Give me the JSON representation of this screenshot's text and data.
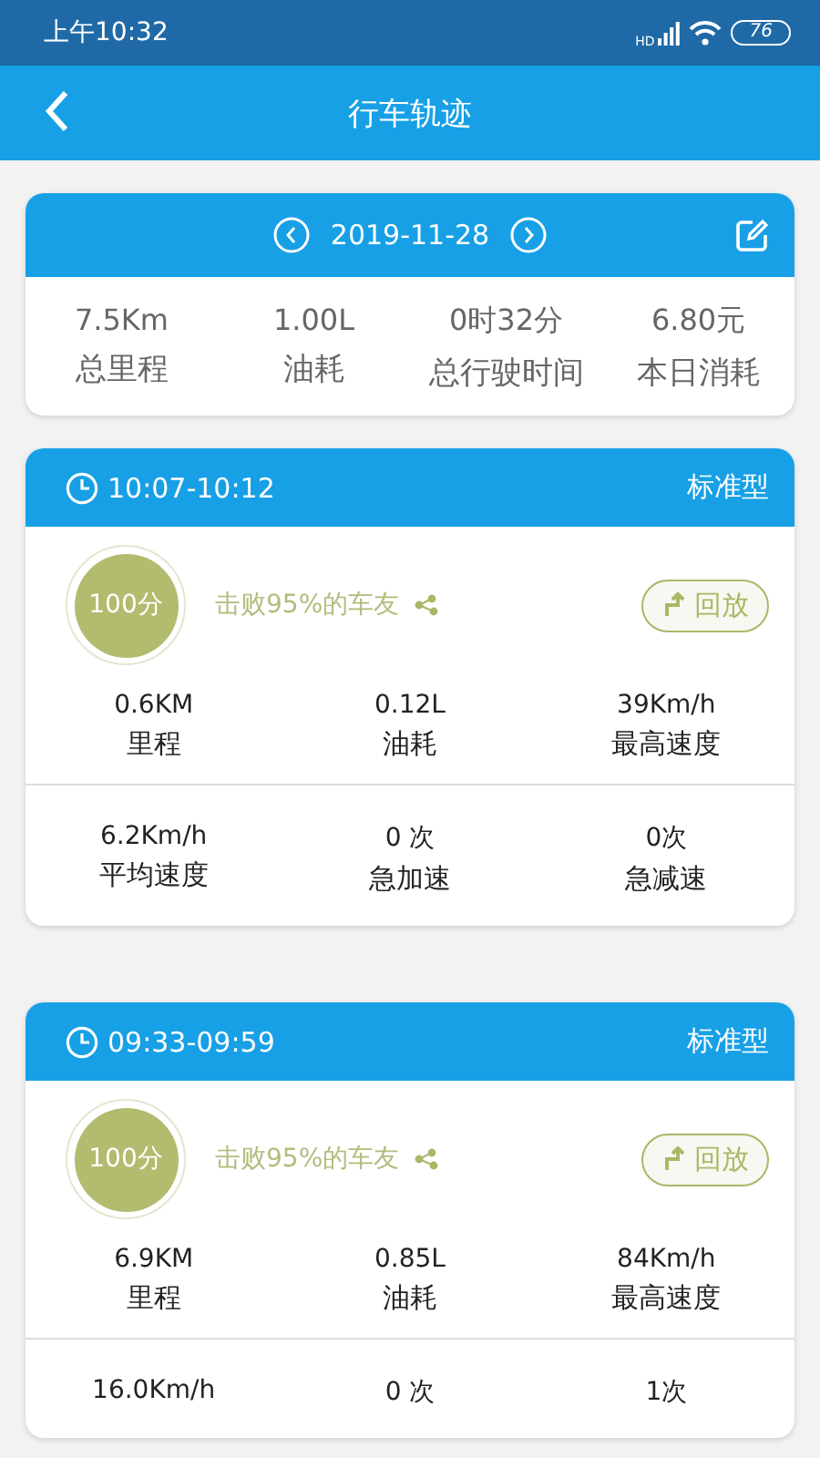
{
  "status_bar": {
    "time": "上午10:32",
    "network": "HD",
    "battery": "76"
  },
  "header": {
    "title": "行车轨迹"
  },
  "summary": {
    "date": "2019-11-28",
    "stats": [
      {
        "value": "7.5Km",
        "label": "总里程"
      },
      {
        "value": "1.00L",
        "label": "油耗"
      },
      {
        "value": "0时32分",
        "label": "总行驶时间"
      },
      {
        "value": "6.80元",
        "label": "本日消耗"
      }
    ]
  },
  "trips": [
    {
      "time": "10:07-10:12",
      "type": "标准型",
      "score": "100分",
      "rank": "击败95%的车友",
      "replay": "回放",
      "stats": [
        {
          "value": "0.6KM",
          "label": "里程"
        },
        {
          "value": "0.12L",
          "label": "油耗"
        },
        {
          "value": "39Km/h",
          "label": "最高速度"
        },
        {
          "value": "6.2Km/h",
          "label": "平均速度"
        },
        {
          "value": "0 次",
          "label": "急加速"
        },
        {
          "value": "0次",
          "label": "急减速"
        }
      ]
    },
    {
      "time": "09:33-09:59",
      "type": "标准型",
      "score": "100分",
      "rank": "击败95%的车友",
      "replay": "回放",
      "stats": [
        {
          "value": "6.9KM",
          "label": "里程"
        },
        {
          "value": "0.85L",
          "label": "油耗"
        },
        {
          "value": "84Km/h",
          "label": "最高速度"
        },
        {
          "value": "16.0Km/h"
        },
        {
          "value": "0 次"
        },
        {
          "value": "1次"
        }
      ]
    }
  ]
}
